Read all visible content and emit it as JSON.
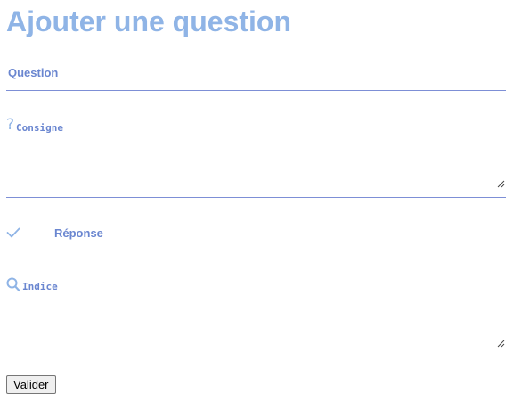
{
  "page": {
    "title": "Ajouter une question"
  },
  "form": {
    "question": {
      "label": "Question",
      "value": ""
    },
    "consigne": {
      "label": "Consigne",
      "icon": "question-mark-icon",
      "icon_glyph": "?",
      "value": ""
    },
    "reponse": {
      "label": "Réponse",
      "icon": "checkmark-icon",
      "value": ""
    },
    "indice": {
      "label": "Indice",
      "icon": "search-icon",
      "value": ""
    },
    "submit_label": "Valider"
  },
  "colors": {
    "title": "#8fb4e6",
    "label": "#6a86d0",
    "underline": "#7d8fd6",
    "icon": "#8fb4e6"
  }
}
